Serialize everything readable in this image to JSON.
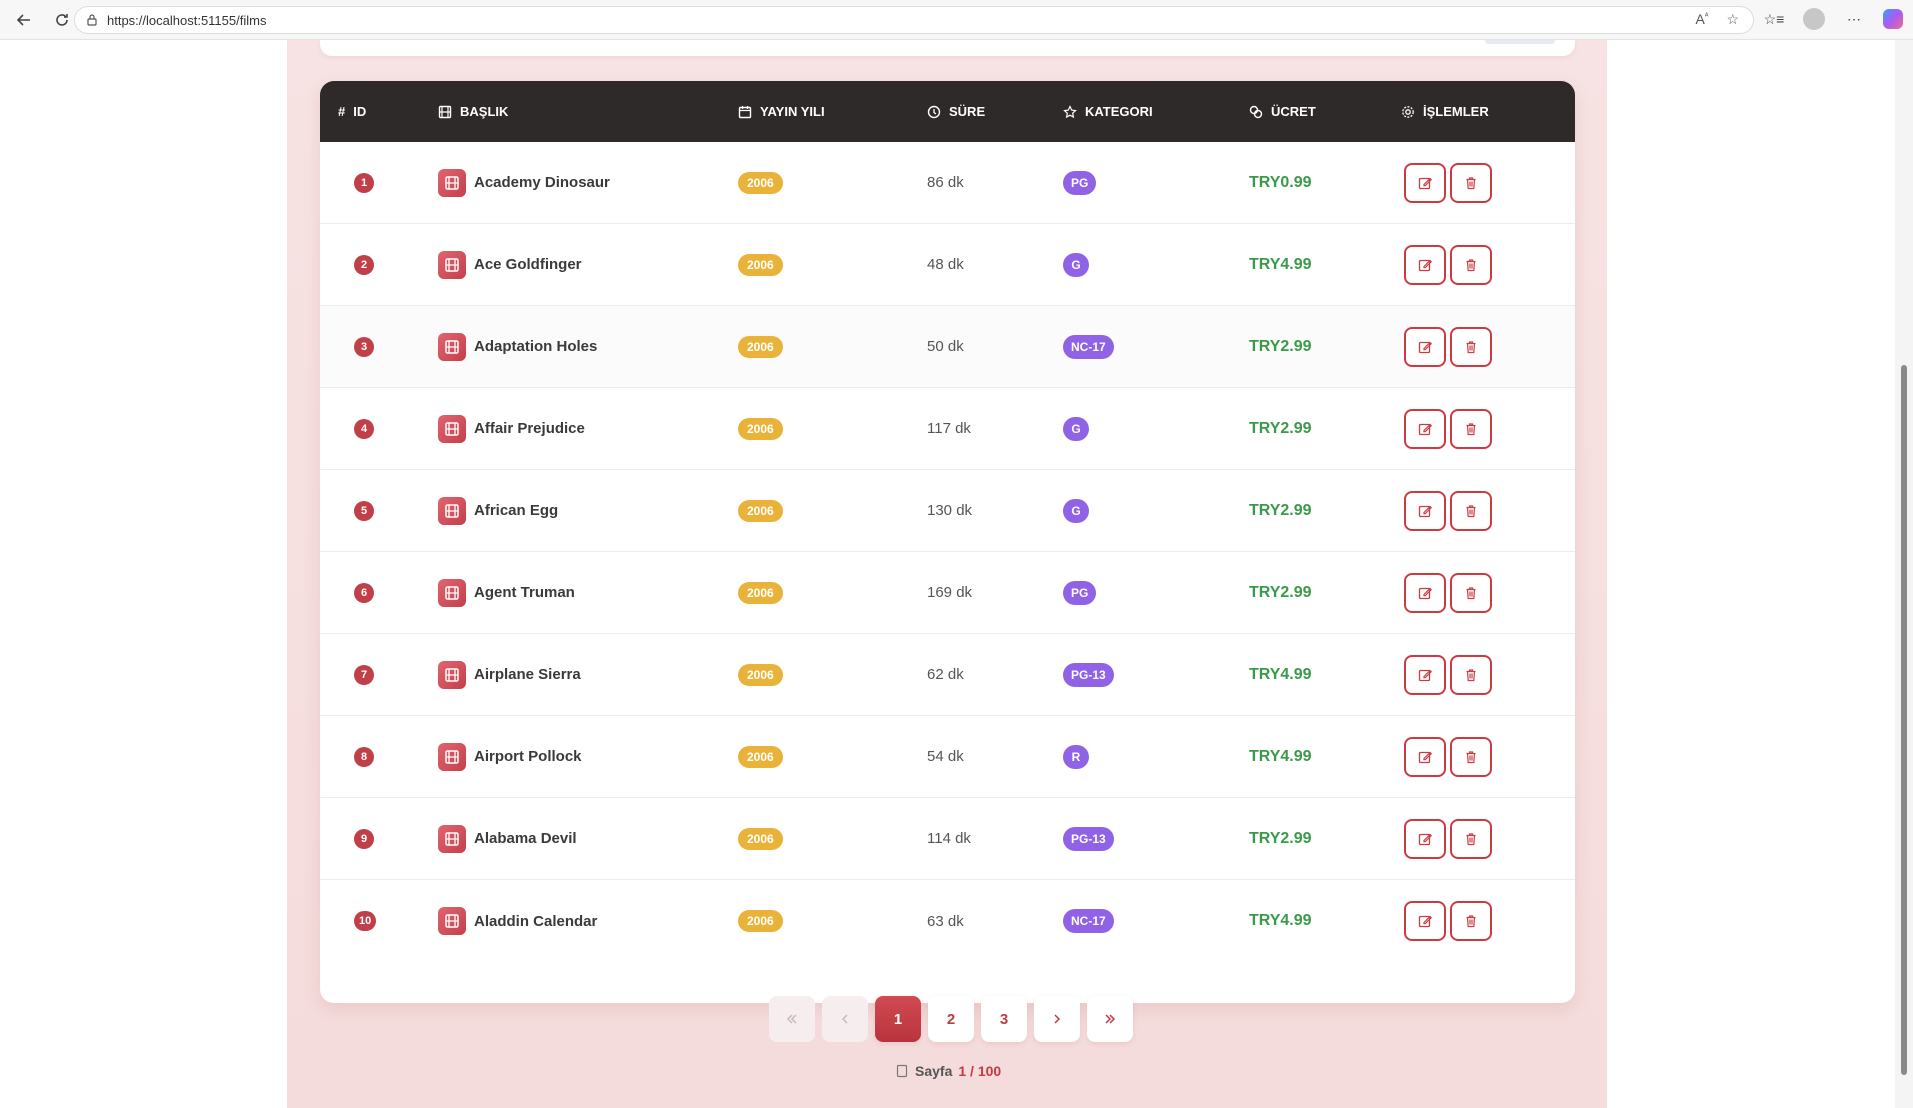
{
  "browser": {
    "url": "https://localhost:51155/films"
  },
  "table": {
    "headers": {
      "id": "ID",
      "title": "BAŞLIK",
      "year": "YAYIN YILI",
      "length": "SÜRE",
      "category": "KATEGORI",
      "price": "ÜCRET",
      "ops": "İŞLEMLER"
    },
    "rows": [
      {
        "id": "1",
        "title": "Academy Dinosaur",
        "year": "2006",
        "length": "86 dk",
        "category": "PG",
        "price": "TRY0.99"
      },
      {
        "id": "2",
        "title": "Ace Goldfinger",
        "year": "2006",
        "length": "48 dk",
        "category": "G",
        "price": "TRY4.99"
      },
      {
        "id": "3",
        "title": "Adaptation Holes",
        "year": "2006",
        "length": "50 dk",
        "category": "NC-17",
        "price": "TRY2.99"
      },
      {
        "id": "4",
        "title": "Affair Prejudice",
        "year": "2006",
        "length": "117 dk",
        "category": "G",
        "price": "TRY2.99"
      },
      {
        "id": "5",
        "title": "African Egg",
        "year": "2006",
        "length": "130 dk",
        "category": "G",
        "price": "TRY2.99"
      },
      {
        "id": "6",
        "title": "Agent Truman",
        "year": "2006",
        "length": "169 dk",
        "category": "PG",
        "price": "TRY2.99"
      },
      {
        "id": "7",
        "title": "Airplane Sierra",
        "year": "2006",
        "length": "62 dk",
        "category": "PG-13",
        "price": "TRY4.99"
      },
      {
        "id": "8",
        "title": "Airport Pollock",
        "year": "2006",
        "length": "54 dk",
        "category": "R",
        "price": "TRY4.99"
      },
      {
        "id": "9",
        "title": "Alabama Devil",
        "year": "2006",
        "length": "114 dk",
        "category": "PG-13",
        "price": "TRY2.99"
      },
      {
        "id": "10",
        "title": "Aladdin Calendar",
        "year": "2006",
        "length": "63 dk",
        "category": "NC-17",
        "price": "TRY4.99"
      }
    ]
  },
  "pagination": {
    "pages": [
      "1",
      "2",
      "3"
    ],
    "current": "1",
    "info_label": "Sayfa",
    "info_value": "1 / 100"
  },
  "colors": {
    "accent": "#c13a44",
    "header_bg": "#2e2a29",
    "year_badge": "#e9b33a",
    "category_badge": "#8f62e6",
    "price": "#3a9a4a"
  }
}
